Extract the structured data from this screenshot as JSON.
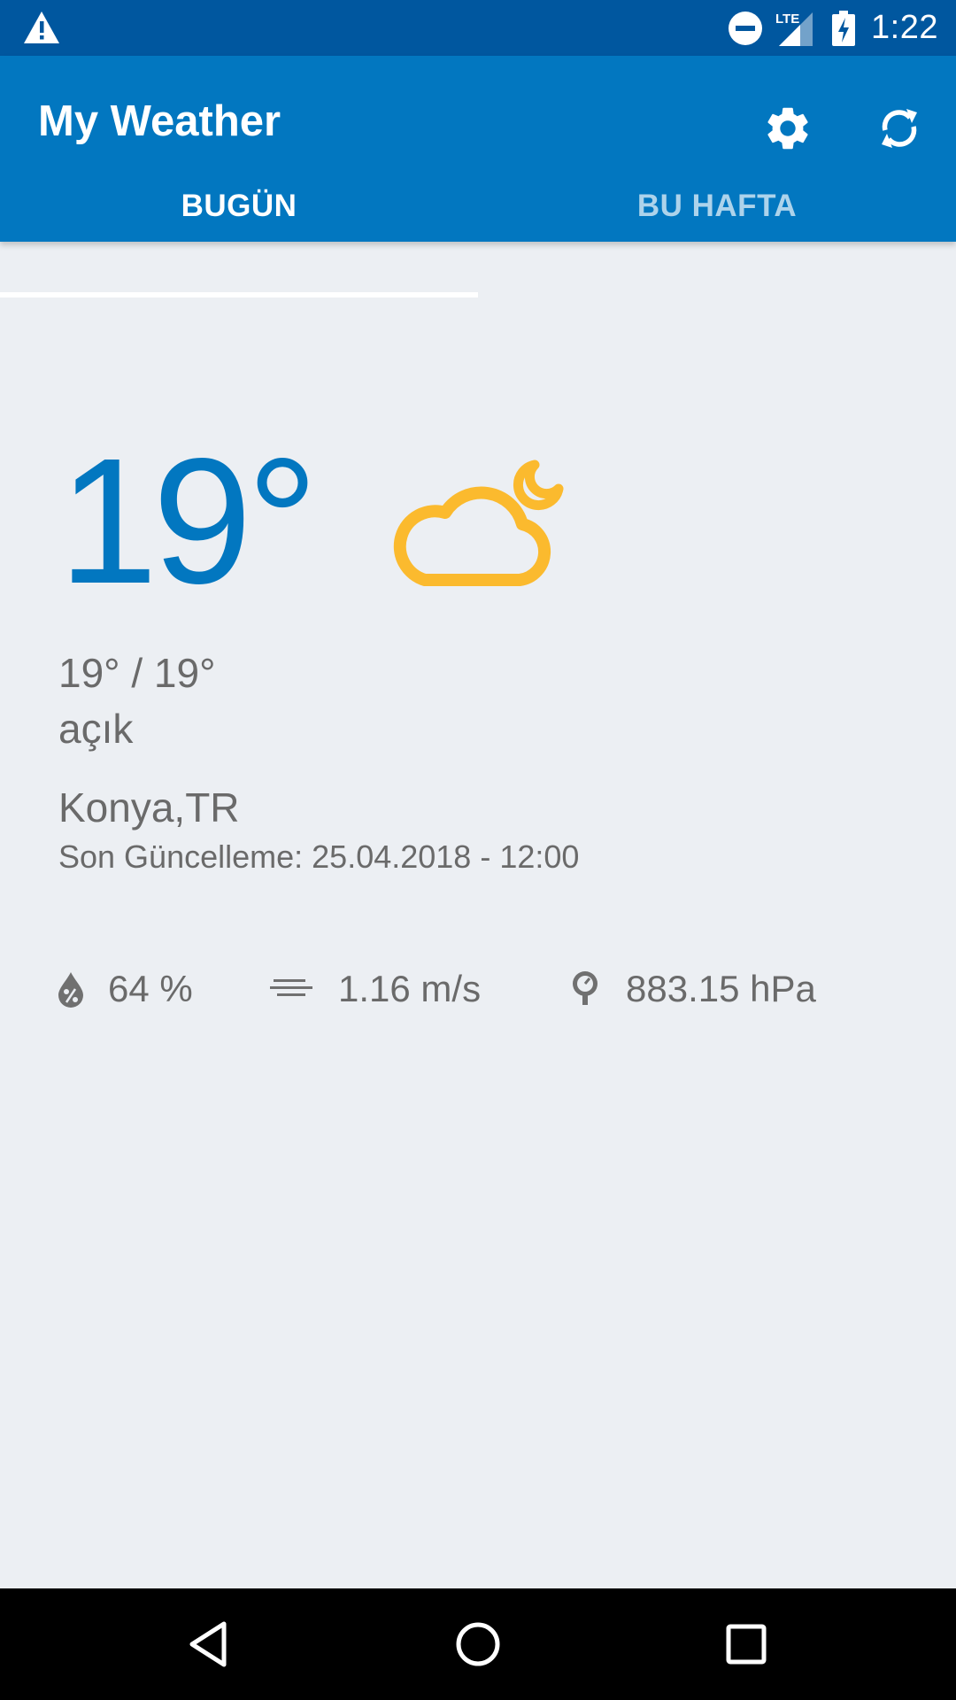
{
  "status_bar": {
    "time": "1:22",
    "network_label": "LTE",
    "icons": [
      "warning-icon",
      "do-not-disturb-icon",
      "lte-signal-icon",
      "battery-charging-icon"
    ]
  },
  "app_bar": {
    "title": "My Weather",
    "actions": [
      "settings-icon",
      "refresh-icon"
    ]
  },
  "tabs": [
    {
      "label": "BUGÜN",
      "selected": true
    },
    {
      "label": "BU HAFTA",
      "selected": false
    }
  ],
  "current": {
    "temperature": "19°",
    "condition_icon": "partly-cloudy-night-icon",
    "min_max": "19° / 19°",
    "description": "açık",
    "location": "Konya,TR",
    "last_updated": "Son Güncelleme: 25.04.2018 - 12:00"
  },
  "metrics": {
    "humidity": {
      "icon": "humidity-icon",
      "value": "64 %"
    },
    "wind": {
      "icon": "wind-icon",
      "value": "1.16 m/s"
    },
    "pressure": {
      "icon": "pressure-gauge-icon",
      "value": "883.15 hPa"
    }
  },
  "navigation": [
    "back-icon",
    "home-icon",
    "recents-icon"
  ],
  "colors": {
    "status_bar": "#00579F",
    "app_bar": "#0277C0",
    "accent_temperature": "#0277C0",
    "weather_icon": "#FBBA2E",
    "background": "#ECEFF3",
    "text_secondary": "#6A6A6A"
  }
}
